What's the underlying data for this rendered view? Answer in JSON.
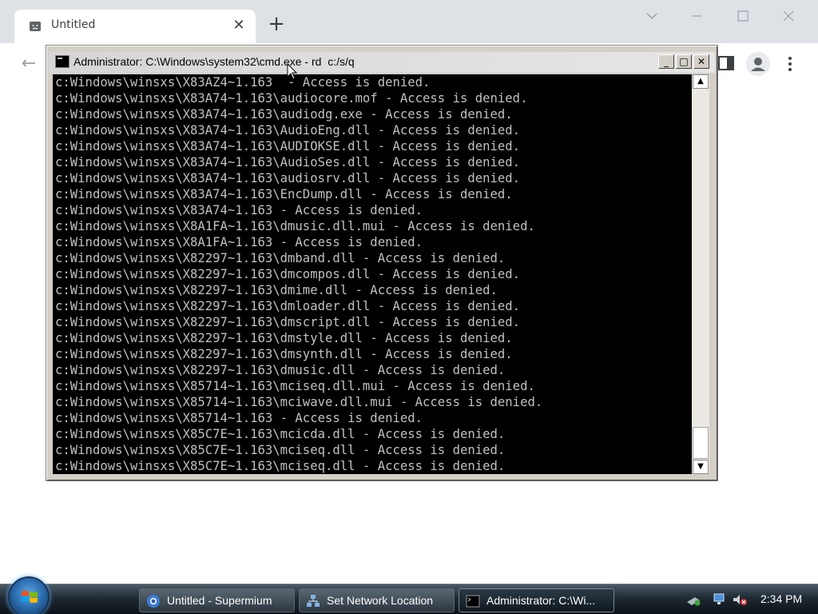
{
  "browser": {
    "tab": {
      "title": "Untitled",
      "close_label": "✕"
    },
    "new_tab_label": "+",
    "back_label": "←"
  },
  "cmd": {
    "title": "Administrator: C:\\Windows\\system32\\cmd.exe - rd  c:/s/q",
    "buttons": {
      "minimize": "_",
      "maximize": "□",
      "close": "✕"
    },
    "lines": [
      "c:Windows\\winsxs\\X83AZ4~1.163  - Access is denied.",
      "c:Windows\\winsxs\\X83A74~1.163\\audiocore.mof - Access is denied.",
      "c:Windows\\winsxs\\X83A74~1.163\\audiodg.exe - Access is denied.",
      "c:Windows\\winsxs\\X83A74~1.163\\AudioEng.dll - Access is denied.",
      "c:Windows\\winsxs\\X83A74~1.163\\AUDIOKSE.dll - Access is denied.",
      "c:Windows\\winsxs\\X83A74~1.163\\AudioSes.dll - Access is denied.",
      "c:Windows\\winsxs\\X83A74~1.163\\audiosrv.dll - Access is denied.",
      "c:Windows\\winsxs\\X83A74~1.163\\EncDump.dll - Access is denied.",
      "c:Windows\\winsxs\\X83A74~1.163 - Access is denied.",
      "c:Windows\\winsxs\\X8A1FA~1.163\\dmusic.dll.mui - Access is denied.",
      "c:Windows\\winsxs\\X8A1FA~1.163 - Access is denied.",
      "c:Windows\\winsxs\\X82297~1.163\\dmband.dll - Access is denied.",
      "c:Windows\\winsxs\\X82297~1.163\\dmcompos.dll - Access is denied.",
      "c:Windows\\winsxs\\X82297~1.163\\dmime.dll - Access is denied.",
      "c:Windows\\winsxs\\X82297~1.163\\dmloader.dll - Access is denied.",
      "c:Windows\\winsxs\\X82297~1.163\\dmscript.dll - Access is denied.",
      "c:Windows\\winsxs\\X82297~1.163\\dmstyle.dll - Access is denied.",
      "c:Windows\\winsxs\\X82297~1.163\\dmsynth.dll - Access is denied.",
      "c:Windows\\winsxs\\X82297~1.163\\dmusic.dll - Access is denied.",
      "c:Windows\\winsxs\\X85714~1.163\\mciseq.dll.mui - Access is denied.",
      "c:Windows\\winsxs\\X85714~1.163\\mciwave.dll.mui - Access is denied.",
      "c:Windows\\winsxs\\X85714~1.163 - Access is denied.",
      "c:Windows\\winsxs\\X85C7E~1.163\\mcicda.dll - Access is denied.",
      "c:Windows\\winsxs\\X85C7E~1.163\\mciseq.dll - Access is denied.",
      "c:Windows\\winsxs\\X85C7E~1.163\\mciseq.dll - Access is denied."
    ],
    "scroll_up": "▲",
    "scroll_down": "▼"
  },
  "taskbar": {
    "items": [
      {
        "label": "Untitled - Supermium",
        "icon": "supermium-icon",
        "active": false
      },
      {
        "label": "Set Network Location",
        "icon": "network-icon",
        "active": false
      },
      {
        "label": "Administrator: C:\\Wi...",
        "icon": "cmd-icon",
        "active": true
      }
    ],
    "clock": "2:34 PM"
  },
  "colors": {
    "tabstrip": "#dee1e6",
    "console_bg": "#000000",
    "console_fg": "#c0c0c0",
    "window_chrome": "#d4d0c8"
  }
}
